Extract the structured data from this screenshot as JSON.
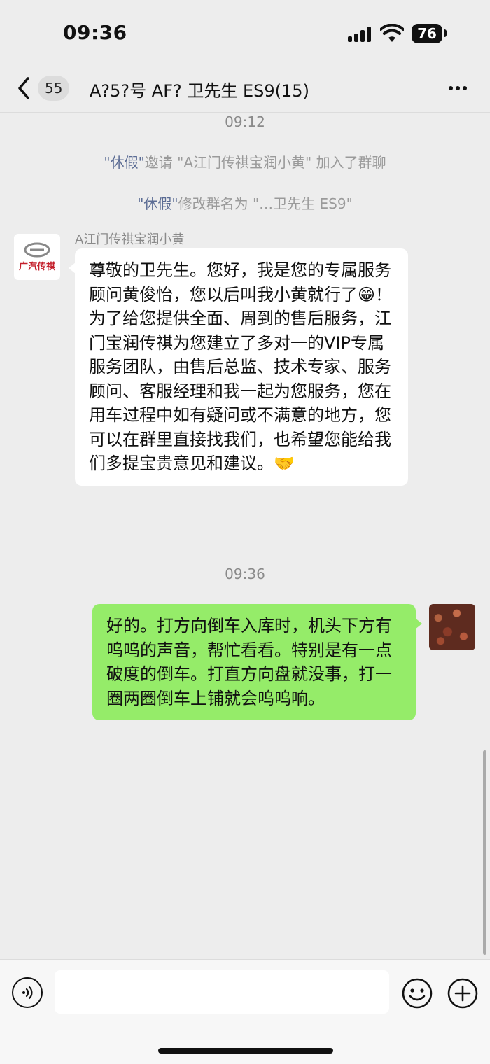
{
  "status_bar": {
    "time": "09:36",
    "battery": "76"
  },
  "header": {
    "back_count": "55",
    "title": "A?5?号 AF? 卫先生 ES9(15)"
  },
  "messages": {
    "timestamp_1": "09:12",
    "system_1": {
      "actor": "\"休假\"",
      "text": "邀请 \"A江门传祺宝润小黄\" 加入了群聊"
    },
    "system_2": {
      "actor": "\"休假\"",
      "text": "修改群名为 \"…卫先生 ES9\""
    },
    "sender_name": "A江门传祺宝润小黄",
    "incoming_text": "尊敬的卫先生。您好，我是您的专属服务顾问黄俊怡，您以后叫我小黄就行了😁！为了给您提供全面、周到的售后服务，江门宝润传祺为您建立了多对一的VIP专属服务团队，由售后总监、技术专家、服务顾问、客服经理和我一起为您服务，您在用车过程中如有疑问或不满意的地方，您可以在群里直接找我们，也希望您能给我们多提宝贵意见和建议。🤝",
    "avatar_logo_text": "广汽传祺",
    "timestamp_2": "09:36",
    "outgoing_text": "好的。打方向倒车入库时，机头下方有呜呜的声音，帮忙看看。特别是有一点破度的倒车。打直方向盘就没事，打一圈两圈倒车上铺就会呜呜响。"
  },
  "input_bar": {
    "placeholder": ""
  },
  "icons": {
    "back": "chevron-left-icon",
    "more": "ellipsis-icon",
    "voice": "voice-icon",
    "emoji": "emoji-icon",
    "plus": "plus-icon",
    "signal": "signal-icon",
    "wifi": "wifi-icon",
    "battery": "battery-icon"
  },
  "colors": {
    "outgoing_bubble": "#95ec69",
    "incoming_bubble": "#ffffff",
    "background": "#ededed",
    "system_actor": "#5b6c94",
    "logo_red": "#c41f2b"
  }
}
